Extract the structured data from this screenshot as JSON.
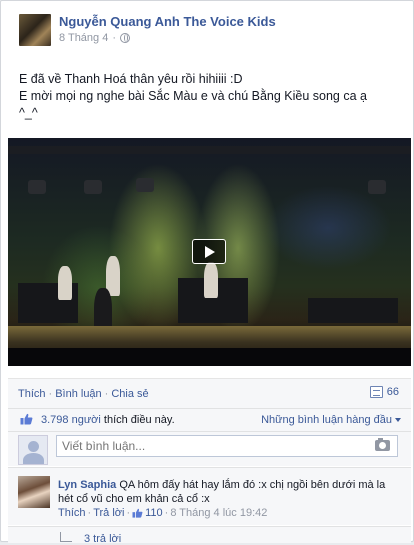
{
  "post": {
    "author": "Nguyễn Quang Anh The Voice Kids",
    "date": "8 Tháng 4",
    "privacy_icon": "globe-icon",
    "text_lines": [
      "E đã về Thanh Hoá thân yêu rồi hihiiii :D",
      "E mời mọi ng nghe bài Sắc Màu e và chú Bằng Kiều song ca ạ",
      "^_^"
    ]
  },
  "video": {
    "play_icon": "play-icon"
  },
  "actions": {
    "like": "Thích",
    "comment": "Bình luận",
    "share": "Chia sẻ",
    "separator": " · ",
    "share_count": "66"
  },
  "likes": {
    "count": "3.798 người",
    "suffix": " thích điều này.",
    "sort_label": "Những bình luận hàng đầu"
  },
  "comment_box": {
    "placeholder": "Viết bình luận..."
  },
  "comment": {
    "author": "Lyn Saphia",
    "text": "QA hôm đấy hát hay lắm đó :x chị ngồi bên dưới mà la hét cổ vũ cho em khản cả cổ :x",
    "like": "Thích",
    "reply": "Trả lời",
    "like_count": "110",
    "timestamp": "8 Tháng 4 lúc 19:42"
  },
  "replies": {
    "label": "3 trả lời"
  },
  "colors": {
    "link": "#3b5998",
    "muted": "#9197a3",
    "panel": "#f6f7f9"
  }
}
